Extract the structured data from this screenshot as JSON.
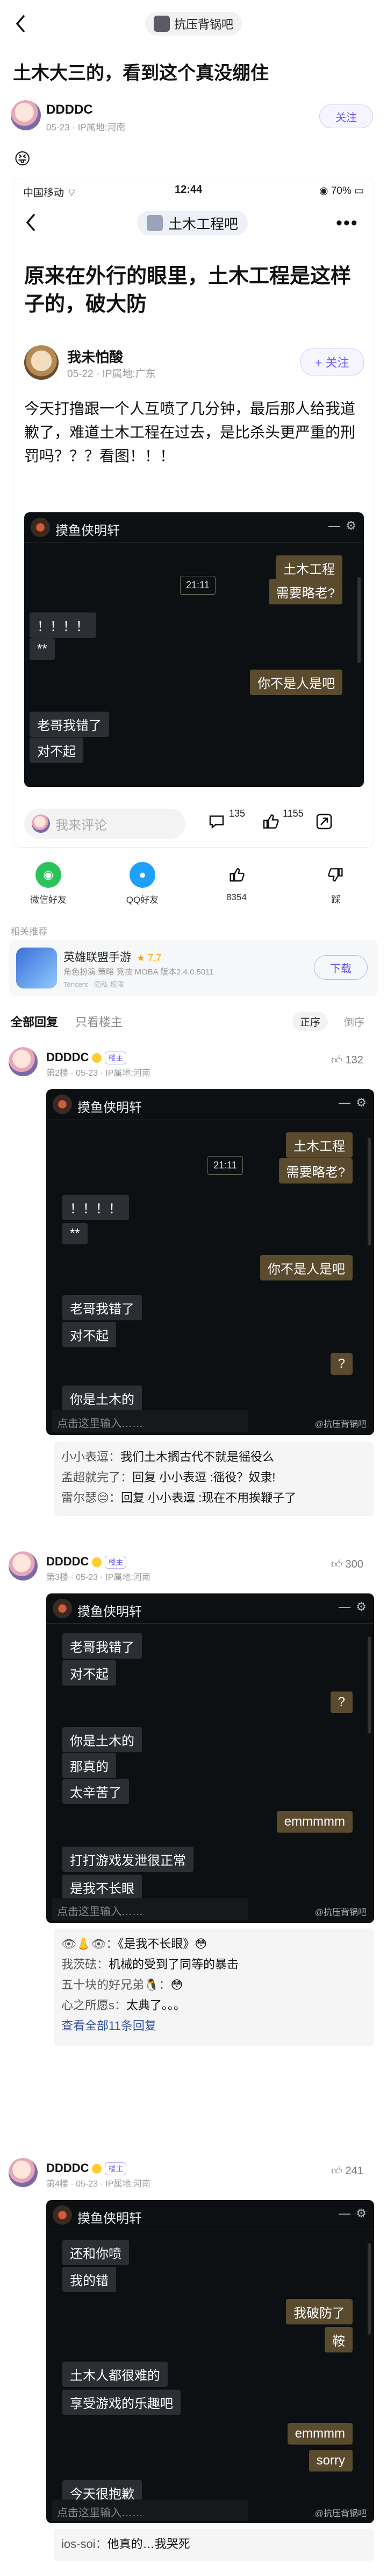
{
  "nav": {
    "forum_name": "抗压背锅吧"
  },
  "post": {
    "title": "土木大三的，看到这个真没绷住",
    "author": "DDDDC",
    "meta": "05-23 · IP属地:河南",
    "follow_label": "关注",
    "emoji": "😝"
  },
  "embed": {
    "status_left": "中国移动 ⌔",
    "status_time": "12:44",
    "status_right": "◉ 70% ▭",
    "forum_name": "土木工程吧",
    "more": "•••",
    "title": "原来在外行的眼里，土木工程是这样子的，破大防",
    "author": "我未怕酸",
    "meta": "05-22 · IP属地:广东",
    "follow_label": "+ 关注",
    "body": "今天打撸跟一个人互喷了几分钟，最后那人给我道歉了，难道土木工程在过去，是比杀头更严重的刑罚吗？？？看图！！！",
    "comment_placeholder": "我来评论",
    "comment_count": "135",
    "like_count": "1155"
  },
  "chat_title": "摸鱼侠明轩",
  "chat1": {
    "time": "21:11",
    "lines": [
      "土木工程",
      "需要略老?",
      "！！！！",
      "**",
      "你不是人是吧",
      "老哥我错了",
      "对不起"
    ]
  },
  "share": {
    "wechat": "微信好友",
    "qq": "QQ好友",
    "likes": "8354",
    "dislike": "踩"
  },
  "recommend_label": "相关推荐",
  "ad": {
    "name": "英雄联盟手游",
    "rating": "★ 7.7",
    "meta": "角色扮演 策略 竞技 MOBA  版本2.4.0.5011",
    "sub": "Tencent · 隐私 权限",
    "download": "下载"
  },
  "tabs": {
    "all": "全部回复",
    "op_only": "只看楼主",
    "sort_asc": "正序",
    "sort_desc": "倒序"
  },
  "comments": [
    {
      "name": "DDDDC",
      "badge": "楼主",
      "meta": "第2楼 · 05-23 · IP属地:河南",
      "likes": "132",
      "chat": {
        "time": "21:11",
        "lines": [
          "土木工程",
          "需要略老?",
          "！！！！",
          "**",
          "你不是人是吧",
          "老哥我错了",
          "对不起",
          "?",
          "你是土木的"
        ],
        "input": "点击这里输入……",
        "watermark": "@抗压背锅吧"
      },
      "replies": [
        {
          "user": "小小表逗：",
          "text": "我们土木搁古代不就是徭役么"
        },
        {
          "user": "孟超就完了：",
          "text": "回复 小小表逗 :徭役？奴隶!"
        },
        {
          "user": "雷尔瑟😔：",
          "text": "回复 小小表逗 :现在不用挨鞭子了"
        }
      ]
    },
    {
      "name": "DDDDC",
      "badge": "楼主",
      "meta": "第3楼 · 05-23 · IP属地:河南",
      "likes": "300",
      "chat": {
        "lines": [
          "老哥我错了",
          "对不起",
          "?",
          "你是土木的",
          "那真的",
          "太辛苦了",
          "emmmmm",
          "打打游戏发泄很正常",
          "是我不长眼"
        ],
        "input": "点击这里输入……",
        "watermark": "@抗压背锅吧"
      },
      "replies": [
        {
          "user": "👁👃👁：",
          "text": "《是我不长眼》😳"
        },
        {
          "user": "我茨砝：",
          "text": "机械的受到了同等的暴击"
        },
        {
          "user": "五十块的好兄弟🐧：",
          "text": "😳"
        },
        {
          "user": "心之所愿s：",
          "text": "太典了。。。"
        }
      ],
      "more": "查看全部11条回复"
    },
    {
      "name": "DDDDC",
      "badge": "楼主",
      "meta": "第4楼 · 05-23 · IP属地:河南",
      "likes": "241",
      "chat": {
        "lines": [
          "还和你喷",
          "我的错",
          "我破防了",
          "鞍",
          "土木人都很难的",
          "享受游戏的乐趣吧",
          "emmmm",
          "sorry",
          "今天很抱歉"
        ],
        "input": "点击这里输入……",
        "watermark": "@抗压背锅吧"
      },
      "replies": [
        {
          "user": "ios-soi：",
          "text": "他真的…我哭死"
        }
      ]
    }
  ],
  "colors": {
    "accent": "#6a5cff",
    "chat_bg": "#0d1012",
    "bubble_me": "#5a4a2e"
  }
}
